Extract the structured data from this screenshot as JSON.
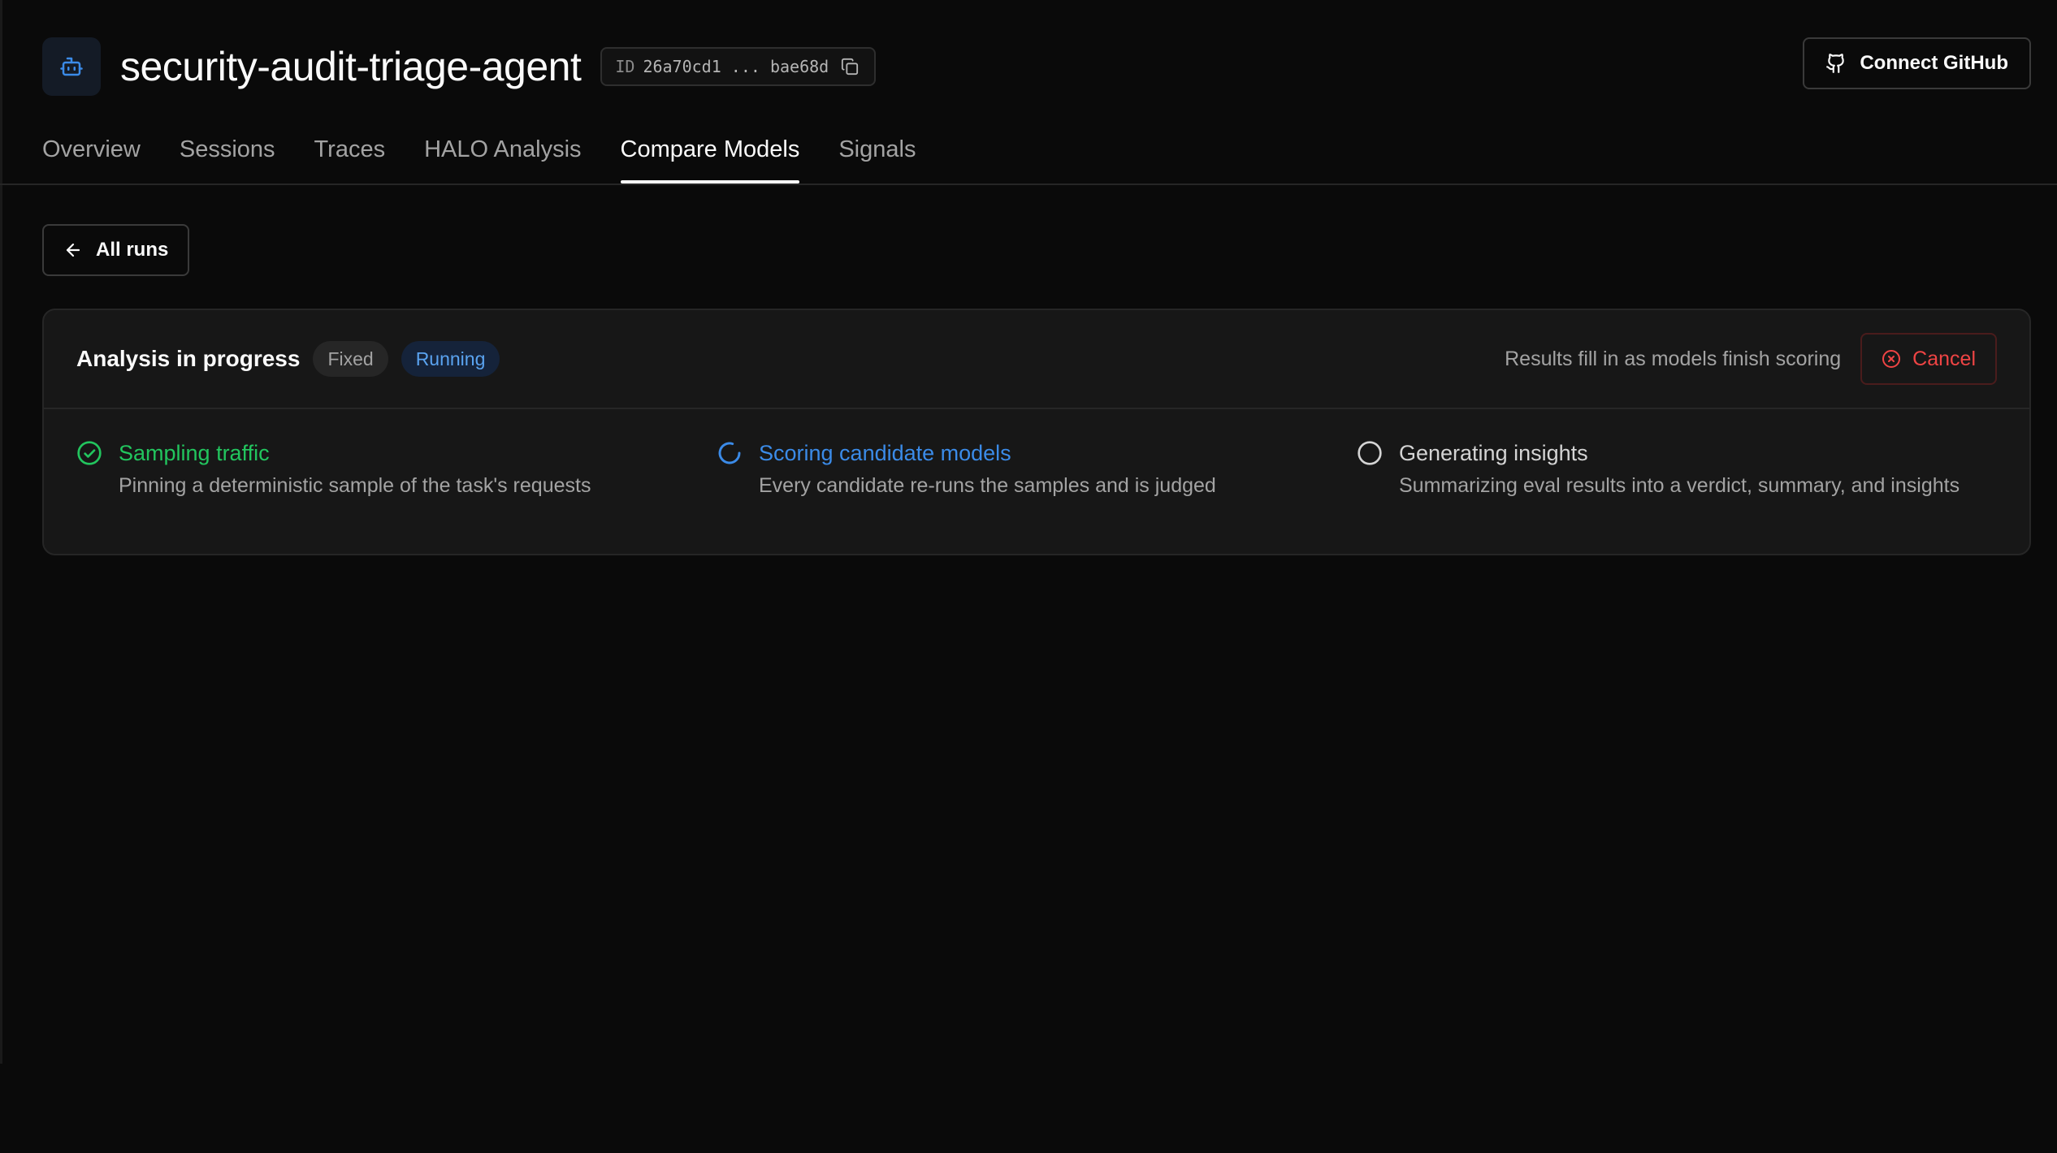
{
  "agent": {
    "name": "security-audit-triage-agent",
    "icon": "bot-icon",
    "id_label": "ID",
    "id_value": "26a70cd1 ... bae68d"
  },
  "header": {
    "connect_github_label": "Connect GitHub"
  },
  "tabs": [
    {
      "label": "Overview",
      "active": false
    },
    {
      "label": "Sessions",
      "active": false
    },
    {
      "label": "Traces",
      "active": false
    },
    {
      "label": "HALO Analysis",
      "active": false
    },
    {
      "label": "Compare Models",
      "active": true
    },
    {
      "label": "Signals",
      "active": false
    }
  ],
  "back_button": {
    "label": "All runs"
  },
  "analysis": {
    "title": "Analysis in progress",
    "badges": {
      "fixed": "Fixed",
      "running": "Running"
    },
    "hint": "Results fill in as models finish scoring",
    "cancel_label": "Cancel",
    "steps": [
      {
        "title": "Sampling traffic",
        "description": "Pinning a deterministic sample of the task's requests",
        "status": "done"
      },
      {
        "title": "Scoring candidate models",
        "description": "Every candidate re-runs the samples and is judged",
        "status": "active"
      },
      {
        "title": "Generating insights",
        "description": "Summarizing eval results into a verdict, summary, and insights",
        "status": "pending"
      }
    ]
  },
  "colors": {
    "background": "#0a0a0a",
    "card": "#171717",
    "done": "#22c55e",
    "active": "#3b8be8",
    "danger": "#ef4444"
  }
}
